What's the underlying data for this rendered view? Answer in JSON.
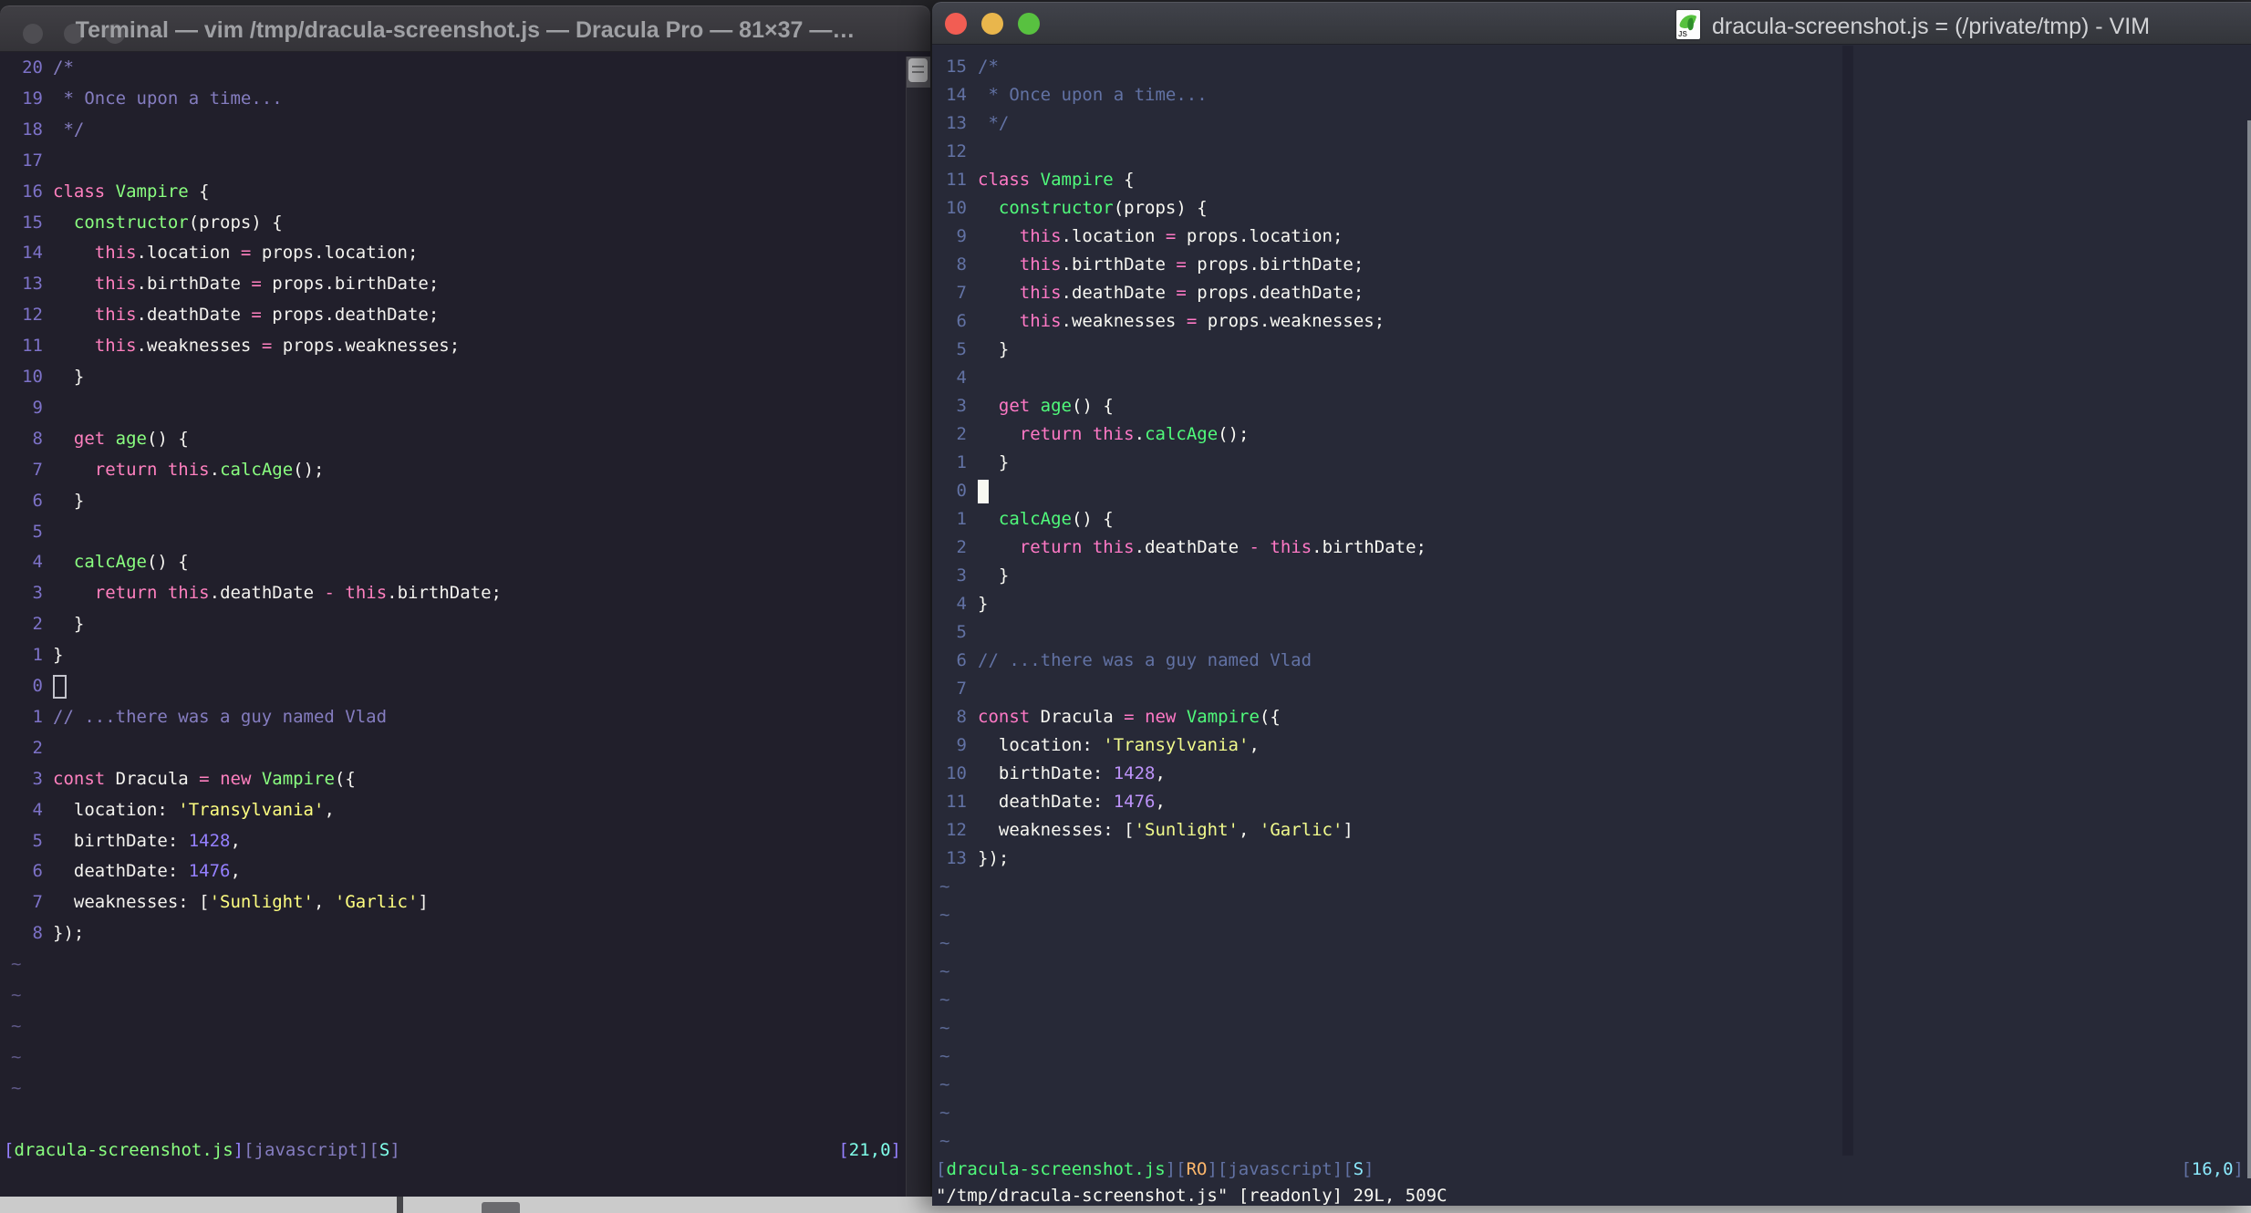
{
  "left_window": {
    "title": "Terminal — vim /tmp/dracula-screenshot.js — Dracula Pro — 81×37 —…",
    "status_segments": [
      [
        "purple",
        "["
      ],
      [
        "green",
        "dracula-screenshot.js"
      ],
      [
        "purple",
        "]"
      ],
      [
        "comment",
        "[javascript]"
      ],
      [
        "comment",
        "["
      ],
      [
        "cyan",
        "S"
      ],
      [
        "comment",
        "]"
      ]
    ],
    "coord_segments": [
      [
        "purple",
        "["
      ],
      [
        "cyan",
        "21,0"
      ],
      [
        "purple",
        "]"
      ]
    ],
    "numbers": [
      20,
      19,
      18,
      17,
      16,
      15,
      14,
      13,
      12,
      11,
      10,
      9,
      8,
      7,
      6,
      5,
      4,
      3,
      2,
      1,
      0,
      1,
      2,
      3,
      4,
      5,
      6,
      7,
      8
    ],
    "tilde_count": 5,
    "cursor": {
      "line": 20,
      "style": "hollow",
      "col": 0
    },
    "theme": {
      "bg": "#211f2b",
      "fg": "#f4f3ef",
      "pink": "#ff80bf",
      "green": "#8aff80",
      "yellow": "#ffff80",
      "purple": "#9580ff",
      "comment": "#857dc0",
      "cyan": "#80ffea",
      "orange": "#ffca80",
      "linenr": "#7d72c8",
      "tilde": "#5e5887"
    }
  },
  "right_window": {
    "title": "dracula-screenshot.js = (/private/tmp) - VIM",
    "file_icon": "js-file-icon",
    "status_segments": [
      [
        "comment",
        "["
      ],
      [
        "green",
        "dracula-screenshot.js"
      ],
      [
        "comment",
        "]["
      ],
      [
        "orange",
        "RO"
      ],
      [
        "comment",
        "]"
      ],
      [
        "comment",
        "[javascript]"
      ],
      [
        "comment",
        "["
      ],
      [
        "cyan",
        "S"
      ],
      [
        "comment",
        "]"
      ]
    ],
    "coord_segments": [
      [
        "comment",
        "["
      ],
      [
        "cyan",
        "16,0"
      ],
      [
        "comment",
        "]"
      ]
    ],
    "command_line": "\"/tmp/dracula-screenshot.js\" [readonly] 29L, 509C",
    "numbers": [
      15,
      14,
      13,
      12,
      11,
      10,
      9,
      8,
      7,
      6,
      5,
      4,
      3,
      2,
      1,
      0,
      1,
      2,
      3,
      4,
      5,
      6,
      7,
      8,
      9,
      10,
      11,
      12,
      13
    ],
    "tilde_count": 10,
    "cursor": {
      "line": 15,
      "style": "block",
      "col": 0
    },
    "theme": {
      "bg": "#272937",
      "fg": "#f8f8f2",
      "pink": "#ff79c6",
      "green": "#50fa7b",
      "yellow": "#f1fa8c",
      "purple": "#bd93f9",
      "comment": "#6272a4",
      "cyan": "#8be9fd",
      "orange": "#ffb86c",
      "linenr": "#6272a4",
      "tilde": "#5c6astat"
    }
  },
  "code_lines": [
    [
      [
        "comment",
        "/*"
      ]
    ],
    [
      [
        "comment",
        " * Once upon a time..."
      ]
    ],
    [
      [
        "comment",
        " */"
      ]
    ],
    [],
    [
      [
        "pink",
        "class"
      ],
      [
        "fg",
        " "
      ],
      [
        "green",
        "Vampire"
      ],
      [
        "fg",
        " {"
      ]
    ],
    [
      [
        "fg",
        "  "
      ],
      [
        "green",
        "constructor"
      ],
      [
        "fg",
        "(props) {"
      ]
    ],
    [
      [
        "fg",
        "    "
      ],
      [
        "pink",
        "this"
      ],
      [
        "fg",
        ".location "
      ],
      [
        "pink",
        "="
      ],
      [
        "fg",
        " props.location;"
      ]
    ],
    [
      [
        "fg",
        "    "
      ],
      [
        "pink",
        "this"
      ],
      [
        "fg",
        ".birthDate "
      ],
      [
        "pink",
        "="
      ],
      [
        "fg",
        " props.birthDate;"
      ]
    ],
    [
      [
        "fg",
        "    "
      ],
      [
        "pink",
        "this"
      ],
      [
        "fg",
        ".deathDate "
      ],
      [
        "pink",
        "="
      ],
      [
        "fg",
        " props.deathDate;"
      ]
    ],
    [
      [
        "fg",
        "    "
      ],
      [
        "pink",
        "this"
      ],
      [
        "fg",
        ".weaknesses "
      ],
      [
        "pink",
        "="
      ],
      [
        "fg",
        " props.weaknesses;"
      ]
    ],
    [
      [
        "fg",
        "  }"
      ]
    ],
    [],
    [
      [
        "fg",
        "  "
      ],
      [
        "pink",
        "get"
      ],
      [
        "fg",
        " "
      ],
      [
        "green",
        "age"
      ],
      [
        "fg",
        "() {"
      ]
    ],
    [
      [
        "fg",
        "    "
      ],
      [
        "pink",
        "return"
      ],
      [
        "fg",
        " "
      ],
      [
        "pink",
        "this"
      ],
      [
        "fg",
        "."
      ],
      [
        "green",
        "calcAge"
      ],
      [
        "fg",
        "();"
      ]
    ],
    [
      [
        "fg",
        "  }"
      ]
    ],
    [],
    [
      [
        "fg",
        "  "
      ],
      [
        "green",
        "calcAge"
      ],
      [
        "fg",
        "() {"
      ]
    ],
    [
      [
        "fg",
        "    "
      ],
      [
        "pink",
        "return"
      ],
      [
        "fg",
        " "
      ],
      [
        "pink",
        "this"
      ],
      [
        "fg",
        ".deathDate "
      ],
      [
        "pink",
        "-"
      ],
      [
        "fg",
        " "
      ],
      [
        "pink",
        "this"
      ],
      [
        "fg",
        ".birthDate;"
      ]
    ],
    [
      [
        "fg",
        "  }"
      ]
    ],
    [
      [
        "fg",
        "}"
      ]
    ],
    [],
    [
      [
        "comment",
        "// ...there was a guy named Vlad"
      ]
    ],
    [],
    [
      [
        "pink",
        "const"
      ],
      [
        "fg",
        " Dracula "
      ],
      [
        "pink",
        "="
      ],
      [
        "fg",
        " "
      ],
      [
        "pink",
        "new"
      ],
      [
        "fg",
        " "
      ],
      [
        "green",
        "Vampire"
      ],
      [
        "fg",
        "({"
      ]
    ],
    [
      [
        "fg",
        "  location: "
      ],
      [
        "yellow",
        "'Transylvania'"
      ],
      [
        "fg",
        ","
      ]
    ],
    [
      [
        "fg",
        "  birthDate: "
      ],
      [
        "purple",
        "1428"
      ],
      [
        "fg",
        ","
      ]
    ],
    [
      [
        "fg",
        "  deathDate: "
      ],
      [
        "purple",
        "1476"
      ],
      [
        "fg",
        ","
      ]
    ],
    [
      [
        "fg",
        "  weaknesses: ["
      ],
      [
        "yellow",
        "'Sunlight'"
      ],
      [
        "fg",
        ", "
      ],
      [
        "yellow",
        "'Garlic'"
      ],
      [
        "fg",
        "]"
      ]
    ],
    [
      [
        "fg",
        "});"
      ]
    ]
  ]
}
